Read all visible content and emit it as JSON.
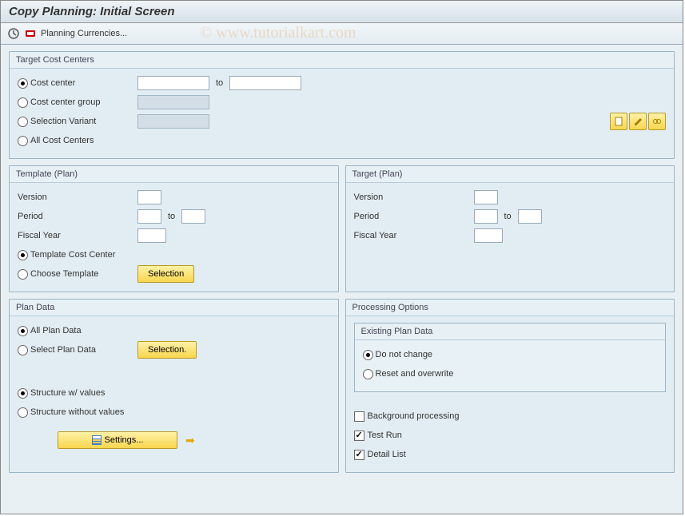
{
  "title": "Copy Planning: Initial Screen",
  "toolbar": {
    "planning_currencies": "Planning Currencies..."
  },
  "watermark": "©   www.tutorialkart.com",
  "target_cost_centers": {
    "title": "Target Cost Centers",
    "cost_center_label": "Cost center",
    "to_label": "to",
    "cost_center_group_label": "Cost center group",
    "selection_variant_label": "Selection Variant",
    "all_cost_centers_label": "All Cost Centers"
  },
  "template_plan": {
    "title": "Template (Plan)",
    "version_label": "Version",
    "period_label": "Period",
    "to_label": "to",
    "fiscal_year_label": "Fiscal Year",
    "template_cc_label": "Template Cost Center",
    "choose_template_label": "Choose Template",
    "selection_btn": "Selection"
  },
  "target_plan": {
    "title": "Target (Plan)",
    "version_label": "Version",
    "period_label": "Period",
    "to_label": "to",
    "fiscal_year_label": "Fiscal Year"
  },
  "plan_data": {
    "title": "Plan Data",
    "all_plan_data_label": "All Plan Data",
    "select_plan_data_label": "Select Plan Data",
    "selection_btn": "Selection.",
    "struct_with_label": "Structure w/ values",
    "struct_without_label": "Structure without values",
    "settings_btn": "Settings..."
  },
  "processing_options": {
    "title": "Processing Options",
    "existing_title": "Existing Plan Data",
    "do_not_change_label": "Do not change",
    "reset_overwrite_label": "Reset and overwrite",
    "background_label": "Background processing",
    "test_run_label": "Test Run",
    "detail_list_label": "Detail List"
  }
}
